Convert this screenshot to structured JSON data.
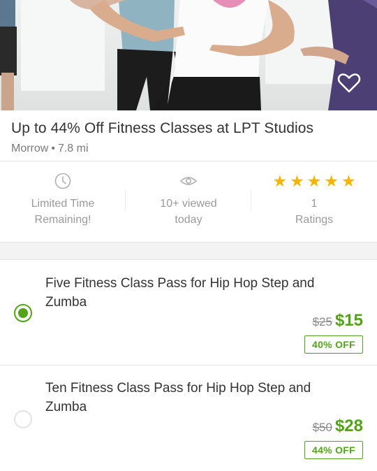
{
  "deal": {
    "title": "Up to 44% Off Fitness Classes at LPT Studios",
    "location": "Morrow",
    "distance": "7.8 mi"
  },
  "hero": {
    "favorite_icon": "heart-outline-icon"
  },
  "stats": {
    "time": {
      "icon": "clock-icon",
      "line1": "Limited Time",
      "line2": "Remaining!"
    },
    "views": {
      "icon": "eye-icon",
      "line1": "10+ viewed",
      "line2": "today"
    },
    "ratings": {
      "icon": "star-icon",
      "stars": 5,
      "line1": "1",
      "line2": "Ratings"
    }
  },
  "options": [
    {
      "title": "Five Fitness Class Pass for Hip Hop Step and Zumba",
      "original_price": "$25",
      "price": "$15",
      "discount": "40% OFF",
      "selected": true
    },
    {
      "title": "Ten Fitness Class Pass for Hip Hop Step and Zumba",
      "original_price": "$50",
      "price": "$28",
      "discount": "44% OFF",
      "selected": false
    }
  ],
  "colors": {
    "accent_green": "#53a318",
    "star_gold": "#f4b400",
    "muted_text": "#9a9a9a"
  }
}
